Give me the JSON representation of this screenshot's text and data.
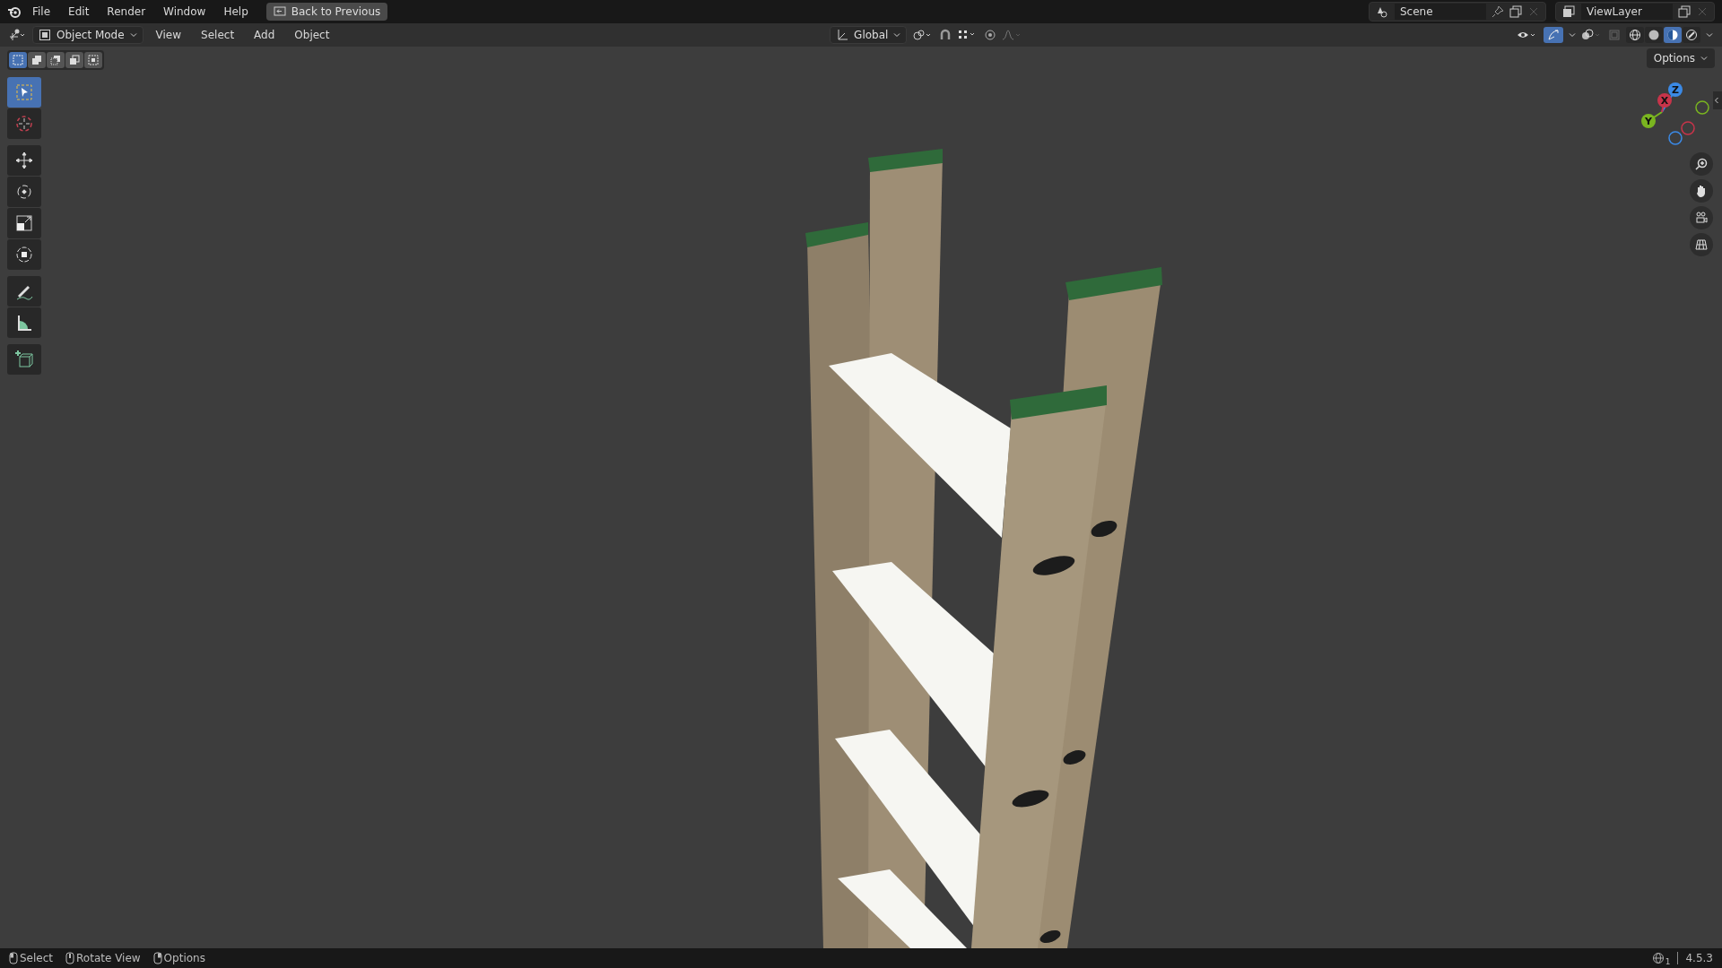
{
  "top_bar": {
    "menus": [
      "File",
      "Edit",
      "Render",
      "Window",
      "Help"
    ],
    "back_button": "Back to Previous",
    "scene": "Scene",
    "view_layer": "ViewLayer"
  },
  "header": {
    "mode": "Object Mode",
    "menus": [
      "View",
      "Select",
      "Add",
      "Object"
    ],
    "orientation": "Global",
    "gizmo_toggle": {
      "on": true
    },
    "shading": [
      {
        "kind": "wireframe",
        "selected": false
      },
      {
        "kind": "solid",
        "selected": false
      },
      {
        "kind": "material",
        "selected": true
      },
      {
        "kind": "rendered",
        "selected": false
      }
    ]
  },
  "select_modes": [
    {
      "kind": "new",
      "selected": true
    },
    {
      "kind": "extend",
      "selected": false
    },
    {
      "kind": "subtract",
      "selected": false
    },
    {
      "kind": "invert",
      "selected": false
    },
    {
      "kind": "intersect",
      "selected": false
    }
  ],
  "options_button": "Options",
  "tools": [
    {
      "kind": "select_box",
      "selected": true
    },
    {
      "kind": "cursor",
      "selected": false
    },
    {
      "kind": "move",
      "selected": false
    },
    {
      "kind": "rotate",
      "selected": false
    },
    {
      "kind": "scale",
      "selected": false
    },
    {
      "kind": "transform",
      "selected": false
    },
    {
      "kind": "annotate",
      "selected": false
    },
    {
      "kind": "measure",
      "selected": false
    },
    {
      "kind": "add_cube",
      "selected": false
    }
  ],
  "gizmo": {
    "axes": [
      {
        "label": "X",
        "color": "#c8344a"
      },
      {
        "label": "Y",
        "color": "#7ab520"
      },
      {
        "label": "Z",
        "color": "#3b8ae6"
      }
    ]
  },
  "status_bar": {
    "hints": [
      {
        "kind": "left",
        "label": "Select"
      },
      {
        "kind": "middle",
        "label": "Rotate View"
      },
      {
        "kind": "right",
        "label": "Options"
      }
    ],
    "scene_count": "1",
    "version": "4.5.3"
  }
}
